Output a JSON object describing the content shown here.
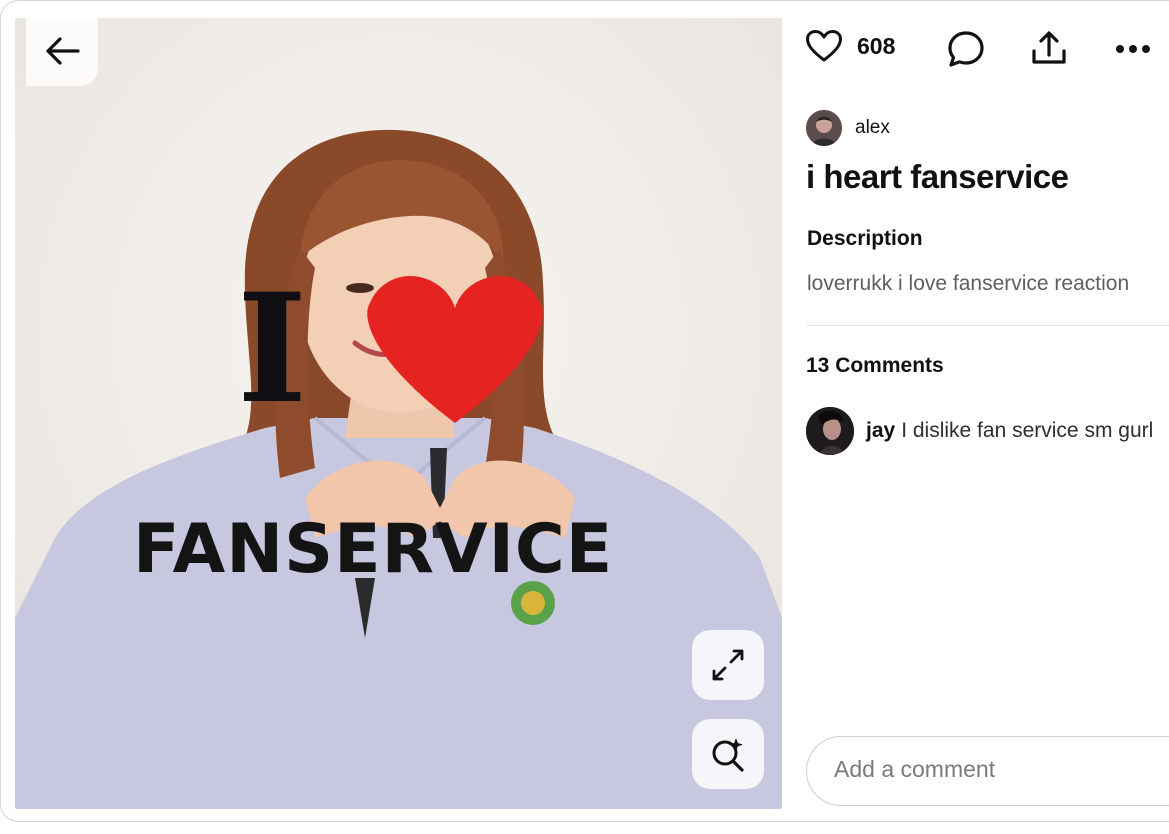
{
  "pin": {
    "image_alt_text_lines": [
      "I",
      "FANSERVICE"
    ],
    "like_count": "608",
    "author": {
      "name": "alex"
    },
    "title": "i heart fanservice",
    "description_heading": "Description",
    "description": "loverrukk i love fanservice reaction",
    "comments_heading": "13 Comments",
    "comments": [
      {
        "user": "jay",
        "text": "I dislike fan service sm gurl"
      }
    ],
    "comment_placeholder": "Add a comment"
  },
  "icons": {
    "back": "arrow-left-icon",
    "like": "heart-outline-icon",
    "comment": "speech-bubble-icon",
    "share": "share-upload-icon",
    "more": "more-dots-icon",
    "expand": "expand-arrows-icon",
    "visual_search": "lens-sparkle-icon"
  },
  "colors": {
    "heart_red": "#e52422",
    "text_primary": "#111111",
    "text_muted": "#5f5f5f"
  }
}
